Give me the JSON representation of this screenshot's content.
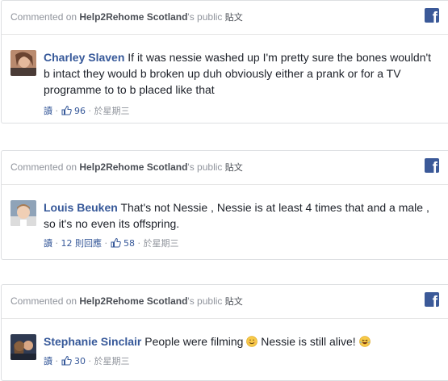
{
  "posts": [
    {
      "header": {
        "prefix": "Commented on ",
        "page_name": "Help2Rehome Scotland",
        "suffix": "'s public ",
        "post_word": "貼文"
      },
      "author": "Charley Slaven",
      "text": "If it was nessie washed up I'm pretty sure the bones wouldn't b intact they would b broken up duh obviously either a prank or for a TV programme to to b placed like that",
      "meta": {
        "read": "讀",
        "likes": "96",
        "time": "於星期三"
      }
    },
    {
      "header": {
        "prefix": "Commented on ",
        "page_name": "Help2Rehome Scotland",
        "suffix": "'s public ",
        "post_word": "貼文"
      },
      "author": "Louis Beuken",
      "text": "That's not Nessie , Nessie is at least 4 times that and a male , so it's no even its offspring.",
      "meta": {
        "read": "讀",
        "replies": "12 則回應",
        "likes": "58",
        "time": "於星期三"
      }
    },
    {
      "header": {
        "prefix": "Commented on ",
        "page_name": "Help2Rehome Scotland",
        "suffix": "'s public ",
        "post_word": "貼文"
      },
      "author": "Stephanie Sinclair",
      "text_part1": "People were filming ",
      "text_part2": " Nessie is still alive! ",
      "meta": {
        "read": "讀",
        "likes": "30",
        "time": "於星期三"
      }
    }
  ],
  "facebook_icon_glyph": "f",
  "colors": {
    "link": "#365899",
    "meta": "#90949c",
    "facebook_blue": "#3b5998",
    "border": "#dddfe2"
  },
  "icons": [
    "facebook-icon",
    "like-thumb-icon",
    "smile-emoji-icon",
    "laugh-emoji-icon"
  ]
}
